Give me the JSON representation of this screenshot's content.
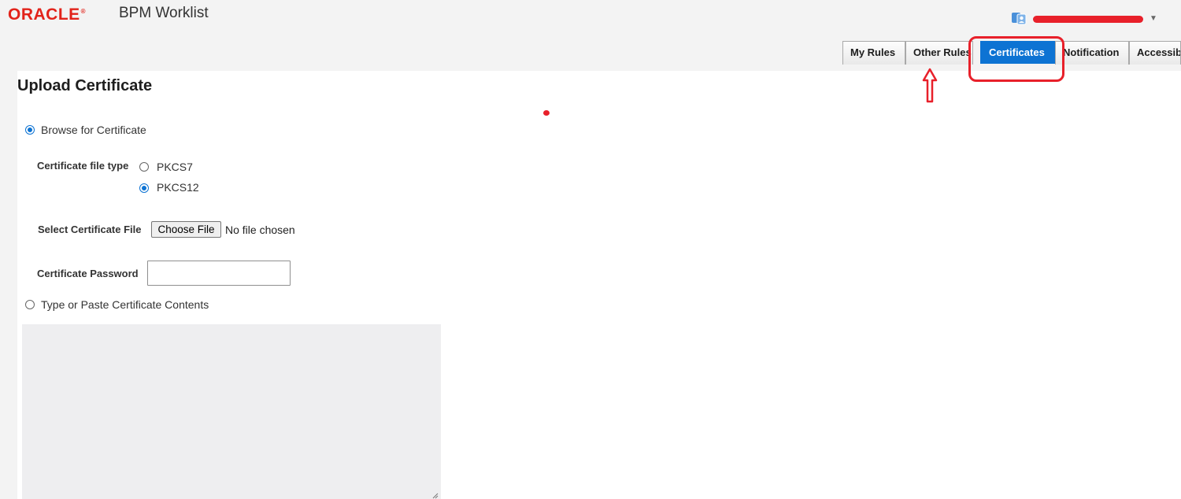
{
  "header": {
    "logo_text": "ORACLE",
    "logo_mark": "®",
    "app_title": "BPM Worklist",
    "user_icon": "user-switch-icon",
    "user_name": "",
    "chevron_icon": "chevron-down-icon"
  },
  "tabs": [
    {
      "label": "My Rules",
      "active": false
    },
    {
      "label": "Other Rules",
      "active": false
    },
    {
      "label": "Certificates",
      "active": true
    },
    {
      "label": "Notification",
      "active": false
    },
    {
      "label": "Accessibility",
      "active": false
    }
  ],
  "colors": {
    "brand_red": "#e2231a",
    "accent_blue": "#0d73d3",
    "annotation_red": "#e8202a"
  },
  "form": {
    "title": "Upload Certificate",
    "browse_option": {
      "label": "Browse for Certificate",
      "selected": true
    },
    "file_type": {
      "label": "Certificate file type",
      "options": [
        {
          "label": "PKCS7",
          "selected": false
        },
        {
          "label": "PKCS12",
          "selected": true
        }
      ]
    },
    "select_file": {
      "label": "Select Certificate File",
      "button_label": "Choose File",
      "status": "No file chosen"
    },
    "password": {
      "label": "Certificate Password",
      "value": ""
    },
    "paste_option": {
      "label": "Type or Paste Certificate Contents",
      "selected": false
    },
    "contents": {
      "value": ""
    }
  }
}
